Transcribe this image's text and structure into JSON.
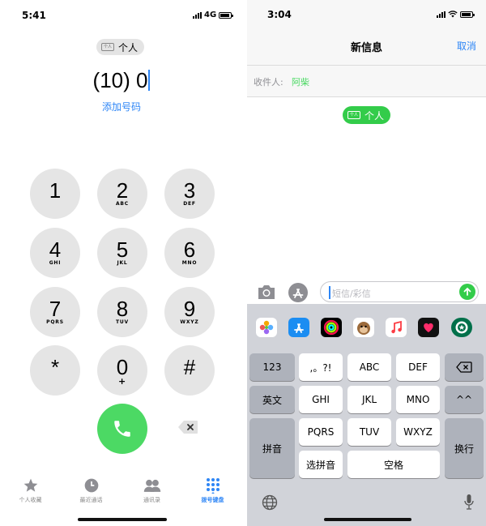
{
  "left_phone": {
    "status": {
      "time": "5:41",
      "network": "4G"
    },
    "contact_chip": {
      "icon": "contact-card-icon",
      "icon_text": "个人",
      "label": "个人"
    },
    "dialed_number": "(10) 0",
    "add_number_label": "添加号码",
    "keypad": [
      {
        "digit": "1",
        "letters": ""
      },
      {
        "digit": "2",
        "letters": "ABC"
      },
      {
        "digit": "3",
        "letters": "DEF"
      },
      {
        "digit": "4",
        "letters": "GHI"
      },
      {
        "digit": "5",
        "letters": "JKL"
      },
      {
        "digit": "6",
        "letters": "MNO"
      },
      {
        "digit": "7",
        "letters": "PQRS"
      },
      {
        "digit": "8",
        "letters": "TUV"
      },
      {
        "digit": "9",
        "letters": "WXYZ"
      },
      {
        "digit": "*",
        "letters": ""
      },
      {
        "digit": "0",
        "letters": "+"
      },
      {
        "digit": "#",
        "letters": ""
      }
    ],
    "tabs": [
      {
        "label": "个人收藏",
        "icon": "star-icon",
        "active": false
      },
      {
        "label": "最近通话",
        "icon": "clock-icon",
        "active": false
      },
      {
        "label": "通讯录",
        "icon": "contacts-icon",
        "active": false
      },
      {
        "label": "拨号键盘",
        "icon": "keypad-icon",
        "active": true
      }
    ],
    "colors": {
      "accent": "#2e86f6",
      "call": "#4cd964",
      "key": "#e5e5e5"
    }
  },
  "right_phone": {
    "status": {
      "time": "3:04"
    },
    "header": {
      "title": "新信息",
      "cancel": "取消"
    },
    "recipient": {
      "label": "收件人:",
      "value": "阿柴"
    },
    "contact_bubble": {
      "icon_text": "个人",
      "label": "个人"
    },
    "message_input": {
      "placeholder": "短信/彩信"
    },
    "app_strip": [
      "photos-icon",
      "app-store-icon",
      "activity-icon",
      "animoji-icon",
      "music-icon",
      "digital-touch-icon",
      "starbucks-icon"
    ],
    "keyboard": {
      "row1": [
        "123",
        ",。?!",
        "ABC",
        "DEF"
      ],
      "row2": [
        "英文",
        "GHI",
        "JKL",
        "MNO",
        "^^"
      ],
      "row3": [
        "拼音",
        "PQRS",
        "TUV",
        "WXYZ",
        "换行"
      ],
      "row4": [
        "选拼音",
        "空格"
      ]
    },
    "colors": {
      "accent": "#2e86f6",
      "green": "#33cc4a",
      "keyboard_bg": "#d1d3d9"
    }
  }
}
